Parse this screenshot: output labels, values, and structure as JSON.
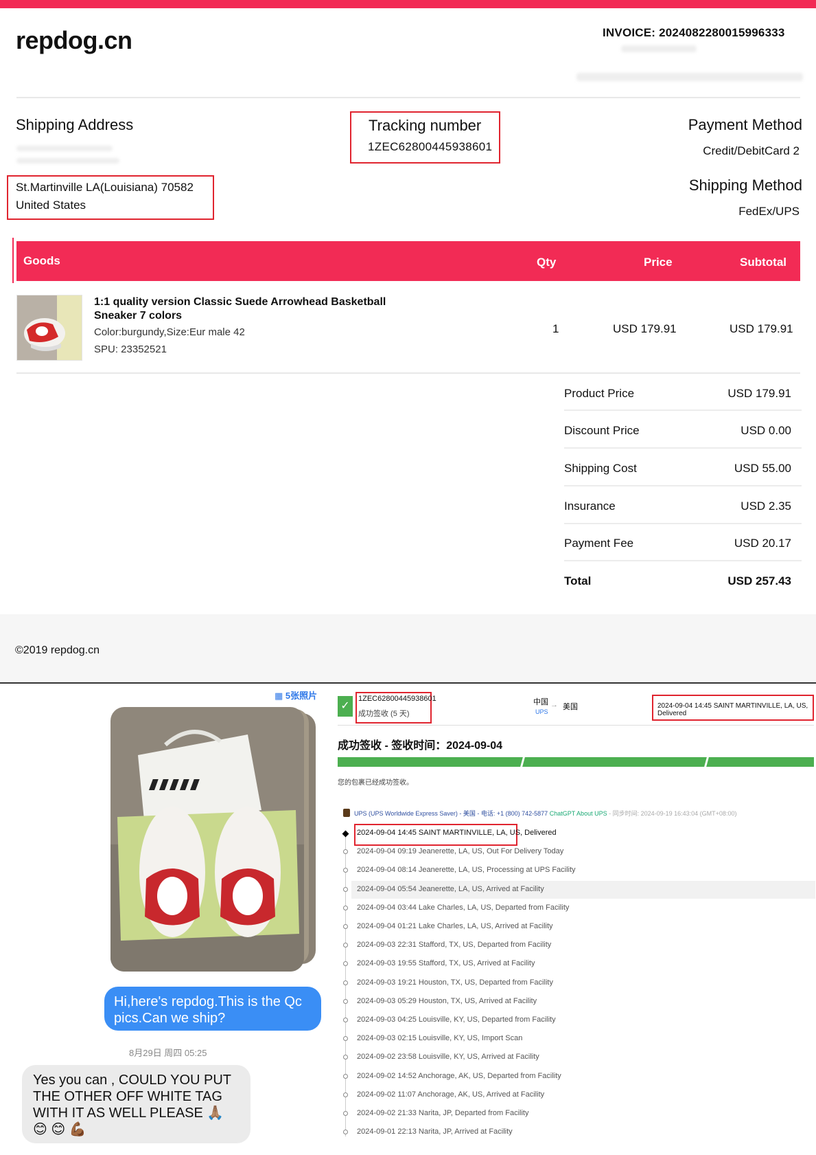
{
  "brand": "repdog.cn",
  "invoice": {
    "label": "INVOICE:",
    "number": "2024082280015996333"
  },
  "shipping_address": {
    "heading": "Shipping Address",
    "line1": "St.Martinville LA(Louisiana) 70582",
    "line2": "United States"
  },
  "tracking": {
    "heading": "Tracking number",
    "number": "1ZEC62800445938601"
  },
  "payment": {
    "heading": "Payment Method",
    "value": "Credit/DebitCard 2"
  },
  "shipping_method": {
    "heading": "Shipping Method",
    "value": "FedEx/UPS"
  },
  "goods_table": {
    "headers": {
      "goods": "Goods",
      "qty": "Qty",
      "price": "Price",
      "subtotal": "Subtotal"
    },
    "item": {
      "title_line1": "1:1 quality version Classic Suede Arrowhead Basketball",
      "title_line2": "Sneaker 7 colors",
      "variant": "Color:burgundy,Size:Eur male 42",
      "spu": "SPU: 23352521",
      "qty": "1",
      "price": "USD 179.91",
      "subtotal": "USD 179.91"
    }
  },
  "summary": [
    {
      "label": "Product Price",
      "value": "USD 179.91"
    },
    {
      "label": "Discount Price",
      "value": "USD 0.00"
    },
    {
      "label": "Shipping Cost",
      "value": "USD 55.00"
    },
    {
      "label": "Insurance",
      "value": "USD 2.35"
    },
    {
      "label": "Payment Fee",
      "value": "USD 20.17"
    },
    {
      "label": "Total",
      "value": "USD 257.43"
    }
  ],
  "footer": "©2019 repdog.cn",
  "chat": {
    "photos_link": "5张照片",
    "outgoing": "Hi,here's repdog.This is the Qc pics.Can we ship?",
    "date": "8月29日 周四 05:25",
    "incoming": "Yes you can , COULD YOU PUT THE OTHER OFF WHITE TAG WITH IT AS WELL PLEASE 🙏🏽 😊 😊 💪🏾"
  },
  "tracking_panel": {
    "number": "1ZEC62800445938601",
    "status_small": "成功签收 (5 天)",
    "origin": "中国",
    "carrier_small": "UPS",
    "dest": "美国",
    "latest": "2024-09-04 14:45 SAINT MARTINVILLE, LA, US, Delivered",
    "title": "成功签收 - 签收时间：2024-09-04",
    "note": "您的包裹已经成功签收。",
    "carrier_line": "UPS (UPS Worldwide Express Saver) - 美国 - 电话: +1 (800) 742-5877",
    "chatgpt": "ChatGPT About UPS",
    "sync": "- 同步时间: 2024-09-19 16:43:04 (GMT+08:00)",
    "events": [
      "2024-09-04 14:45 SAINT MARTINVILLE, LA, US, Delivered",
      "2024-09-04 09:19  Jeanerette, LA, US, Out For Delivery Today",
      "2024-09-04 08:14  Jeanerette, LA, US, Processing at UPS Facility",
      "2024-09-04 05:54  Jeanerette, LA, US, Arrived at Facility",
      "2024-09-04 03:44  Lake Charles, LA, US, Departed from Facility",
      "2024-09-04 01:21  Lake Charles, LA, US, Arrived at Facility",
      "2024-09-03 22:31  Stafford, TX, US, Departed from Facility",
      "2024-09-03 19:55  Stafford, TX, US, Arrived at Facility",
      "2024-09-03 19:21  Houston, TX, US, Departed from Facility",
      "2024-09-03 05:29  Houston, TX, US, Arrived at Facility",
      "2024-09-03 04:25  Louisville, KY, US, Departed from Facility",
      "2024-09-03 02:15  Louisville, KY, US, Import Scan",
      "2024-09-02 23:58  Louisville, KY, US, Arrived at Facility",
      "2024-09-02 14:52  Anchorage, AK, US, Departed from Facility",
      "2024-09-02 11:07  Anchorage, AK, US, Arrived at Facility",
      "2024-09-02 21:33  Narita, JP, Departed from Facility",
      "2024-09-01 22:13  Narita, JP, Arrived at Facility"
    ]
  },
  "colors": {
    "accent": "#f22b55",
    "highlight_box": "#e0242f",
    "chat_blue": "#3a8ef5",
    "progress_green": "#4caf50"
  }
}
